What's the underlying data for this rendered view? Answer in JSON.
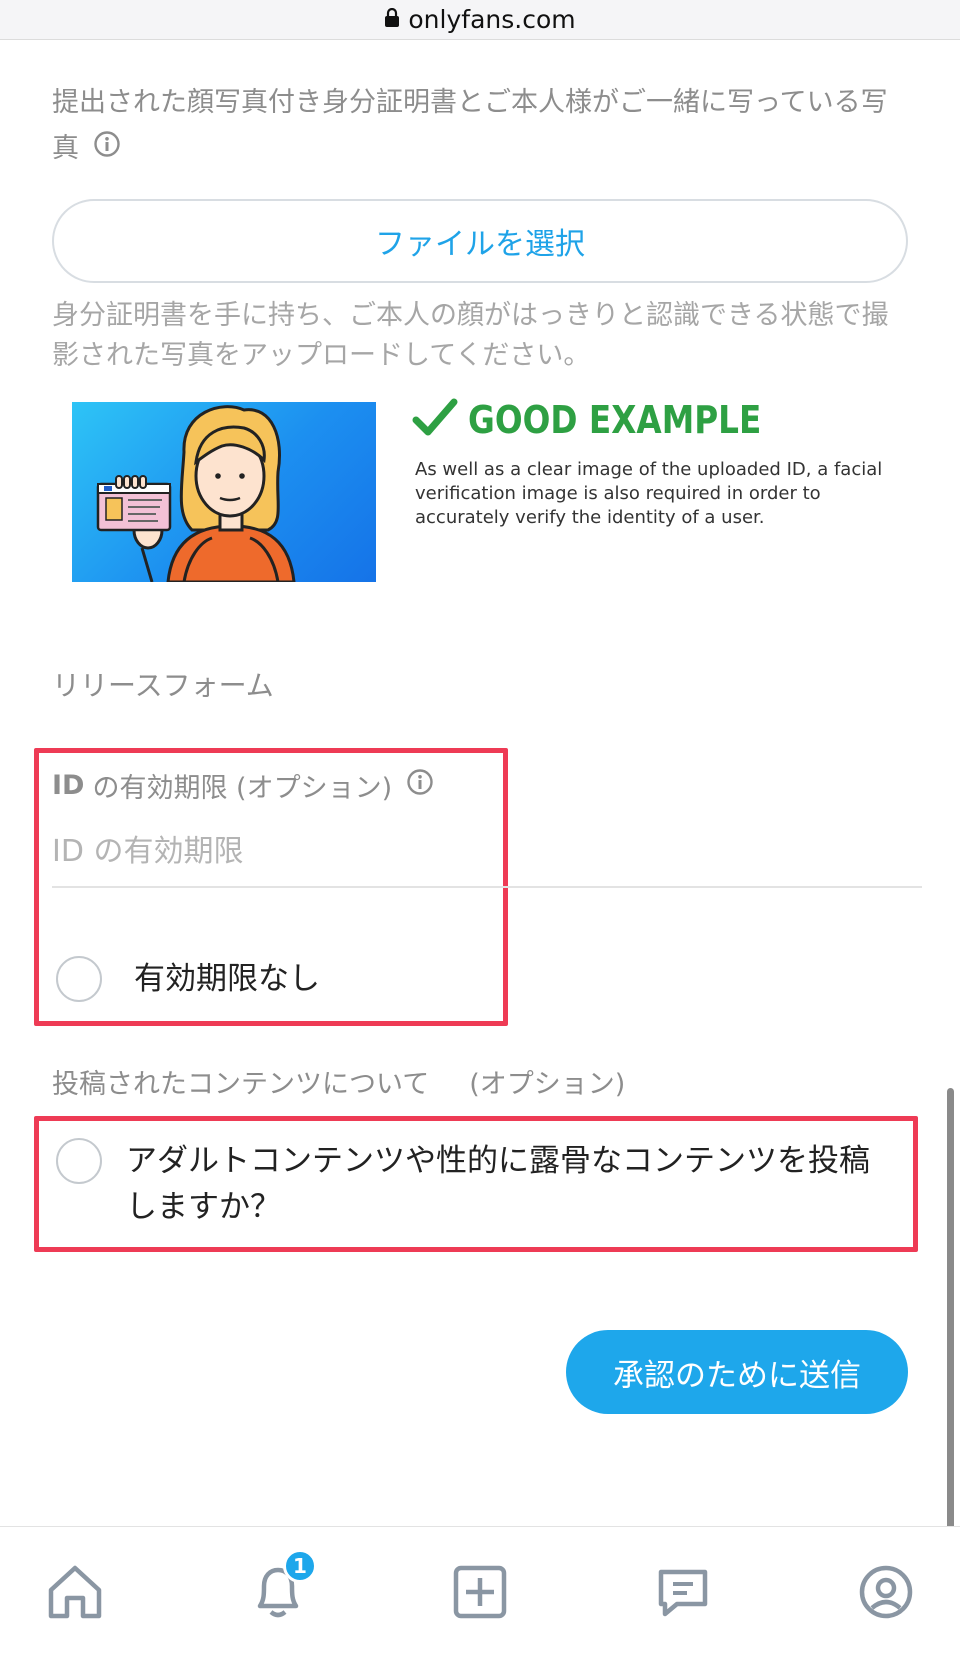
{
  "browser": {
    "url": "onlyfans.com"
  },
  "photo_upload": {
    "label": "提出された顔写真付き身分証明書とご本人様がご一緒に写っている写真",
    "file_button": "ファイルを選択",
    "helper": "身分証明書を手に持ち、ご本人の顔がはっきりと認識できる状態で撮影された写真をアップロードしてください。",
    "example": {
      "title": "GOOD EXAMPLE",
      "description": "As well as a clear image of the uploaded ID, a facial verification image is also required in order to accurately verify the identity of a user."
    }
  },
  "release_form": {
    "label": "リリースフォーム"
  },
  "id_expiration": {
    "label_prefix": "ID",
    "label": "の有効期限 (オプション)",
    "placeholder": "ID の有効期限",
    "no_expiry_label": "有効期限なし"
  },
  "content": {
    "label": "投稿されたコンテンツについて",
    "optional": "(オプション)",
    "adult_question": "アダルトコンテンツや性的に露骨なコンテンツを投稿しますか？"
  },
  "submit": {
    "label": "承認のために送信"
  },
  "bottom_nav": {
    "notification_count": "1"
  },
  "colors": {
    "accent": "#1ea7eb",
    "highlight": "#ee3b55",
    "good": "#2ea043"
  }
}
